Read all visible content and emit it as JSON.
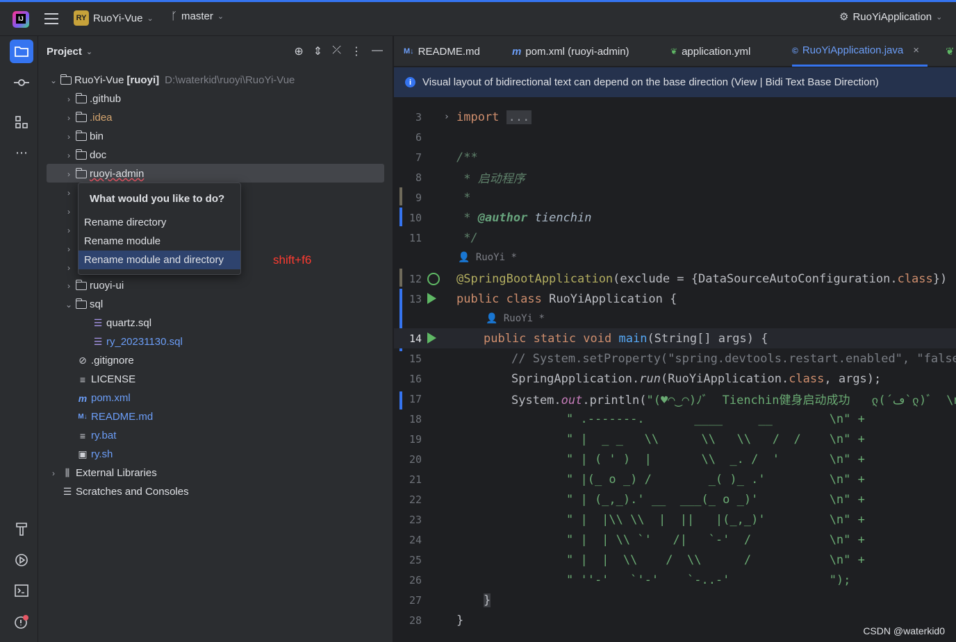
{
  "titlebar": {
    "project_badge": "RY",
    "project_name": "RuoYi-Vue",
    "branch": "master",
    "run_config": "RuoYiApplication"
  },
  "project_panel": {
    "title": "Project",
    "root": {
      "name": "RuoYi-Vue",
      "module": "[ruoyi]",
      "path": "D:\\waterkid\\ruoyi\\RuoYi-Vue"
    },
    "items": [
      {
        "label": ".github",
        "kind": "folder"
      },
      {
        "label": ".idea",
        "kind": "folder"
      },
      {
        "label": "bin",
        "kind": "folder"
      },
      {
        "label": "doc",
        "kind": "folder"
      },
      {
        "label": "ruoyi-admin",
        "kind": "module"
      },
      {
        "label": "ruoyi-ui",
        "kind": "folder"
      },
      {
        "label": "sql",
        "kind": "folder"
      },
      {
        "label": "quartz.sql",
        "kind": "sql"
      },
      {
        "label": "ry_20231130.sql",
        "kind": "sql"
      },
      {
        "label": ".gitignore",
        "kind": "ignore"
      },
      {
        "label": "LICENSE",
        "kind": "text"
      },
      {
        "label": "pom.xml",
        "kind": "maven"
      },
      {
        "label": "README.md",
        "kind": "markdown"
      },
      {
        "label": "ry.bat",
        "kind": "text"
      },
      {
        "label": "ry.sh",
        "kind": "shell"
      },
      {
        "label": "External Libraries",
        "kind": "library"
      },
      {
        "label": "Scratches and Consoles",
        "kind": "scratch"
      }
    ]
  },
  "popup": {
    "title": "What would you like to do?",
    "items": [
      "Rename directory",
      "Rename module",
      "Rename module and directory"
    ],
    "selected": "Rename module and directory"
  },
  "shortcut_note": "shift+f6",
  "tabs": [
    {
      "label": "README.md",
      "icon": "M↓"
    },
    {
      "label": "pom.xml (ruoyi-admin)",
      "icon": "m"
    },
    {
      "label": "application.yml",
      "icon": "yml"
    },
    {
      "label": "RuoYiApplication.java",
      "icon": "java",
      "active": true
    }
  ],
  "banner": {
    "text": "Visual layout of bidirectional text can depend on the base direction (View | Bidi Text Base Direction)"
  },
  "editor": {
    "line_numbers": [
      "3",
      "6",
      "7",
      "8",
      "9",
      "10",
      "11",
      "12",
      "13",
      "14",
      "15",
      "16",
      "17",
      "18",
      "19",
      "20",
      "21",
      "22",
      "23",
      "24",
      "25",
      "26",
      "27",
      "28"
    ],
    "hint_author": "RuoYi *",
    "import_kw": "import",
    "import_fold": "...",
    "doc_open": "/**",
    "doc_line1": "启动程序",
    "doc_star": "*",
    "doc_author_tag": "@author",
    "doc_author": "tienchin",
    "doc_close": "*/",
    "annotation": "@SpringBootApplication",
    "annotation_args": "(exclude = {DataSourceAutoConfiguration.",
    "class_kw": "class",
    "annotation_end": "})",
    "class_decl_kw": "public class",
    "class_name": "RuoYiApplication {",
    "main_kw": "public static void",
    "main_name": "main",
    "main_args": "(String[] args) {",
    "comment_line": "// System.setProperty(\"spring.devtools.restart.enabled\", \"false\");",
    "run_line_a": "SpringApplication.",
    "run_line_b": "run",
    "run_line_c": "(RuoYiApplication.",
    "run_line_d": "class",
    "run_line_e": ", args);",
    "println_a": "System.",
    "println_b": "out",
    "println_c": ".println(",
    "println_str": "\"(♥◠‿◠)ﾉﾞ  Tienchin健身启动成功   ლ(´ڡ`ლ)ﾞ  \\n\" +",
    "ascii_lines": [
      "\" .-------.       ____     __        \\n\" +",
      "\" |  _ _   \\\\      \\\\   \\\\   /  /    \\n\" +",
      "\" | ( ' )  |       \\\\  _. /  '       \\n\" +",
      "\" |(_ o _) /        _( )_ .'         \\n\" +",
      "\" | (_,_).' __  ___(_ o _)'          \\n\" +",
      "\" |  |\\\\ \\\\  |  ||   |(_,_)'         \\n\" +",
      "\" |  | \\\\ `'   /|   `-'  /           \\n\" +",
      "\" |  |  \\\\    /  \\\\      /           \\n\" +",
      "\" ''-'   `'-'    `-..-'              \");"
    ],
    "close_method": "}",
    "close_class": "}"
  },
  "watermark": "CSDN @waterkid0",
  "colors": {
    "accent": "#3574f0",
    "shortcut_note": "#ff3b30"
  }
}
